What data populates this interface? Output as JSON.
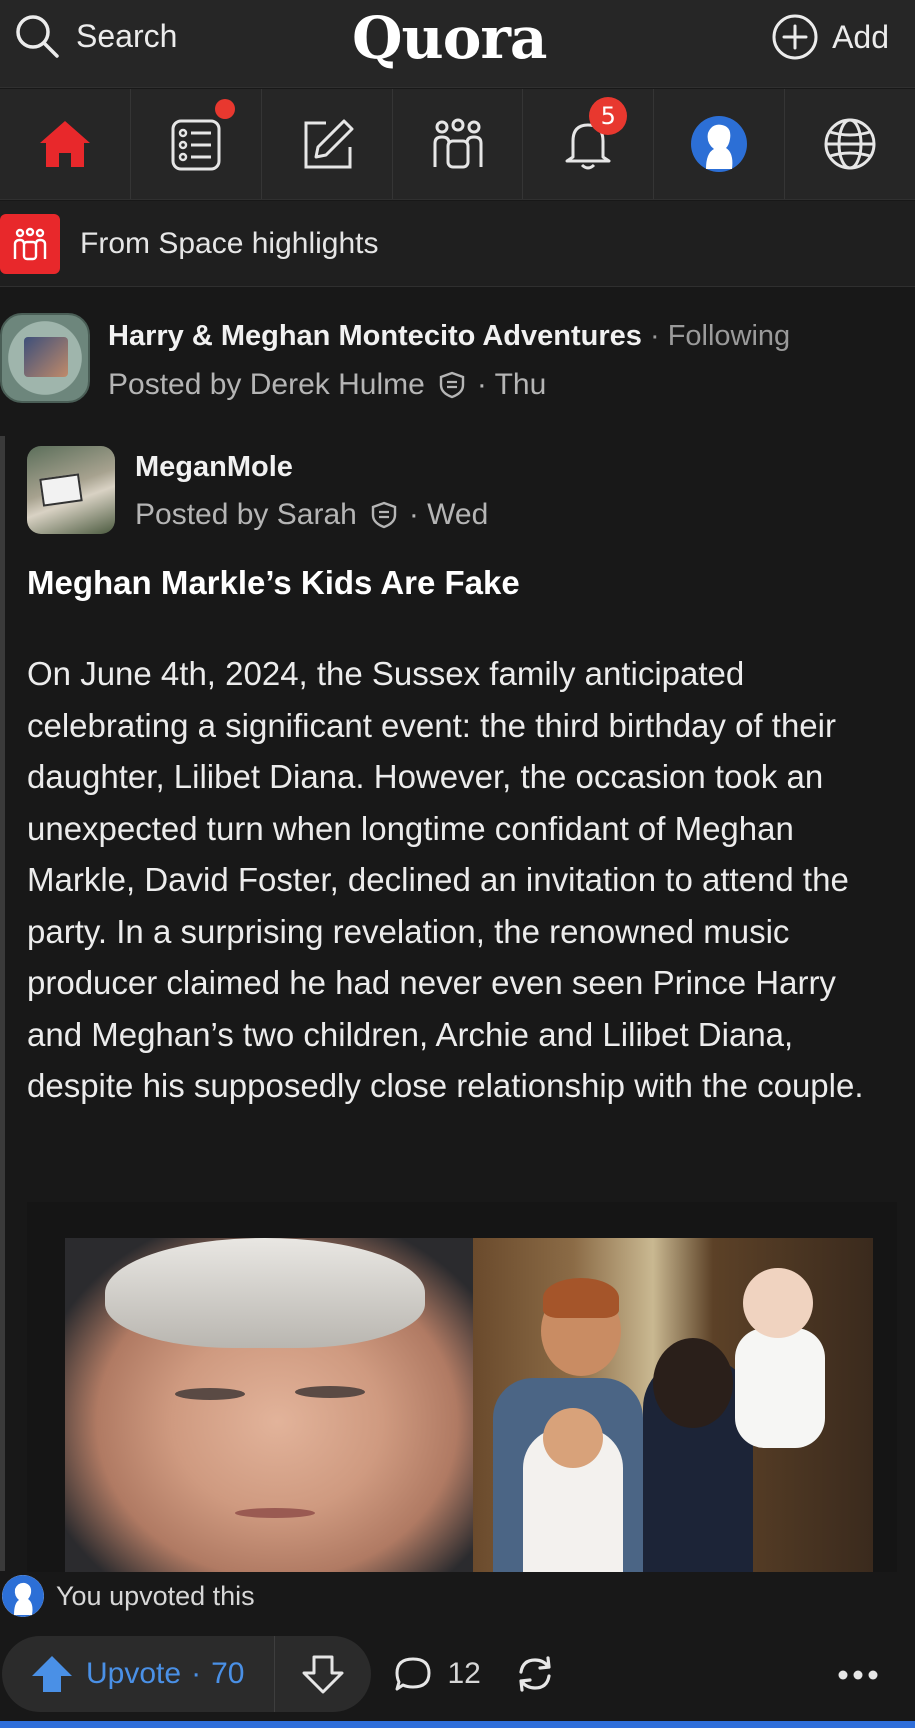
{
  "header": {
    "search_label": "Search",
    "brand": "Quora",
    "add_label": "Add"
  },
  "nav": {
    "items": [
      {
        "name": "home",
        "icon": "home-icon",
        "active": true
      },
      {
        "name": "following",
        "icon": "feed-list-icon",
        "has_dot": true
      },
      {
        "name": "answer",
        "icon": "edit-icon"
      },
      {
        "name": "spaces",
        "icon": "people-icon"
      },
      {
        "name": "notifications",
        "icon": "bell-icon",
        "badge": "5"
      },
      {
        "name": "profile",
        "icon": "profile-avatar-icon"
      },
      {
        "name": "languages",
        "icon": "globe-icon"
      }
    ],
    "notification_badge": "5",
    "active_color": "#e8282b",
    "badge_color": "#e8382f"
  },
  "space_highlights": {
    "label": "From Space highlights"
  },
  "post": {
    "space_name": "Harry & Meghan Montecito Adventures",
    "separator": " · ",
    "following_label": "Following",
    "posted_by_prefix": "Posted by Derek Hulme",
    "posted_time": "· Thu",
    "shared": {
      "author_name": "MeganMole",
      "posted_by_prefix": "Posted by Sarah",
      "posted_time": "· Wed",
      "title": "Meghan Markle’s Kids Are Fake",
      "body": "On June 4th, 2024, the Sussex family anticipated celebrating a significant event: the third birthday of their daughter, Lilibet Diana. However, the occasion took an unexpected turn when longtime confidant of Meghan Markle, David Foster, declined an invitation to attend the party. In a surprising revelation, the renowned music producer claimed he had never even seen Prince Harry and Meghan’s two children, Archie and Lilibet Diana, despite his supposedly close relationship with the couple."
    }
  },
  "engagement": {
    "upvoted_label": "You upvoted this",
    "upvote_label": "Upvote",
    "upvote_separator": "·",
    "upvote_count": "70",
    "comment_count": "12",
    "accent_color": "#4a90e6"
  }
}
